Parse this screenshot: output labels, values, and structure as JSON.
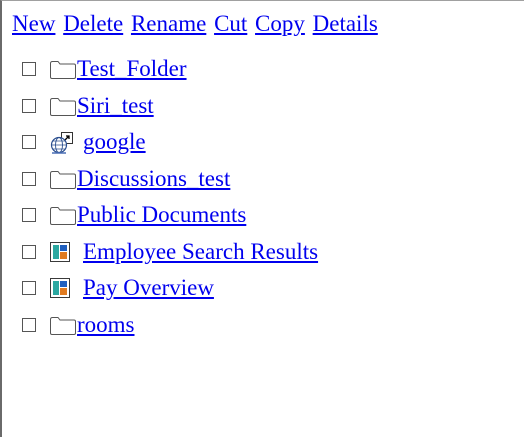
{
  "toolbar": {
    "new_label": "New",
    "delete_label": "Delete",
    "rename_label": "Rename",
    "cut_label": "Cut",
    "copy_label": "Copy",
    "details_label": "Details"
  },
  "items": [
    {
      "name": "Test_Folder",
      "icon": "folder-icon"
    },
    {
      "name": "Siri_test",
      "icon": "folder-icon"
    },
    {
      "name": "google",
      "icon": "web-link-icon"
    },
    {
      "name": "Discussions_test",
      "icon": "folder-icon"
    },
    {
      "name": "Public Documents",
      "icon": "folder-icon"
    },
    {
      "name": "Employee Search Results",
      "icon": "report-icon"
    },
    {
      "name": "Pay Overview",
      "icon": "report-icon"
    },
    {
      "name": "rooms",
      "icon": "folder-icon"
    }
  ],
  "colors": {
    "link": "#0000ee",
    "frame_border": "#6a6a6a",
    "report_blue": "#1f5fbf",
    "report_orange": "#e07a1f",
    "report_teal": "#2aa7a0"
  }
}
